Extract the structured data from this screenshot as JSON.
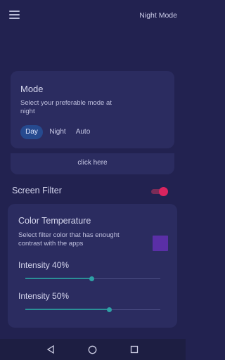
{
  "app": {
    "title": "Night Mode"
  },
  "mode_card": {
    "title": "Mode",
    "description": "Select your preferable mode at night",
    "options": [
      "Day",
      "Night",
      "Auto"
    ],
    "selected": "Day"
  },
  "click_here": {
    "label": "click here"
  },
  "screen_filter": {
    "label": "Screen Filter",
    "enabled": true
  },
  "color_temperature": {
    "title": "Color Temperature",
    "description": "Select filter color that has enought contrast with the apps",
    "swatch_color": "#5a2fa6"
  },
  "intensity_1": {
    "label": "Intensity 40%",
    "value_fraction": 0.49
  },
  "intensity_2": {
    "label": "Intensity 50%",
    "value_fraction": 0.62
  },
  "colors": {
    "background": "#222250",
    "card": "#2b2c60",
    "accent_toggle": "#d9245f",
    "accent_slider": "#2ea1a6",
    "selected_mode_bg": "#264a8f"
  },
  "nav": {
    "back_icon": "back-triangle-icon",
    "home_icon": "home-circle-icon",
    "recent_icon": "recent-square-icon"
  }
}
